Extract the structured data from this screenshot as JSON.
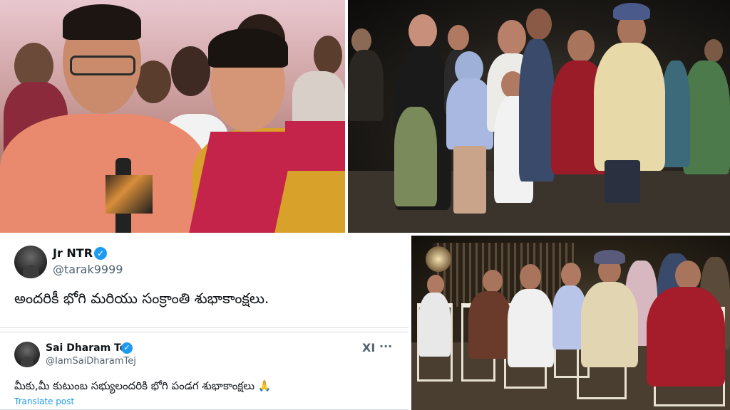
{
  "collage": {
    "photos": [
      {
        "position": "top-left",
        "subject": "news-interview-couple-with-microphone"
      },
      {
        "position": "top-right",
        "subject": "family-group-night-outdoors"
      },
      {
        "position": "bottom-right",
        "subject": "family-seated-on-chairs-night"
      }
    ]
  },
  "tweets": [
    {
      "name": "Jr NTR",
      "handle": "@tarak9999",
      "verified_icon": "verified-badge",
      "text": "అందరికీ భోగి మరియు సంక్రాంతి శుభాకాంక్షలు."
    },
    {
      "name": "Sai Dharam Tej",
      "handle": "@IamSaiDharamTej",
      "verified_icon": "verified-badge",
      "text": "మీకు,మీ కుటుంబ సభ్యులందరికి భోగి పండగ శుభాకాంక్షలు 🙏",
      "translate_label": "Translate post",
      "grok_label": "XI",
      "more_label": "···"
    }
  ],
  "colors": {
    "verified": "#1d9bf0",
    "link": "#1d9bf0",
    "handle": "#536471",
    "text": "#0f1419"
  }
}
